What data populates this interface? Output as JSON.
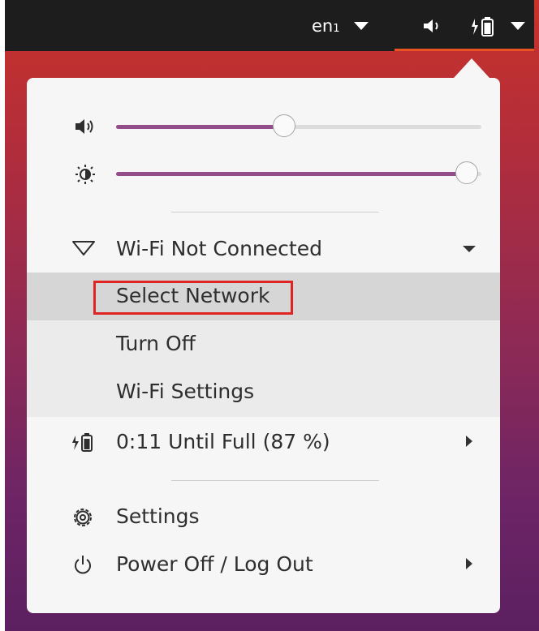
{
  "topbar": {
    "lang_main": "en",
    "lang_sub": "1",
    "icons": [
      "volume-icon",
      "battery-charging-icon",
      "chevron-down-icon"
    ]
  },
  "menu": {
    "volume_level_percent": 46,
    "brightness_level_percent": 96,
    "wifi": {
      "label": "Wi-Fi Not Connected",
      "submenu": [
        {
          "label": "Select Network"
        },
        {
          "label": "Turn Off"
        },
        {
          "label": "Wi-Fi Settings"
        }
      ]
    },
    "battery_label": "0:11 Until Full (87 %)",
    "settings_label": "Settings",
    "power_label": "Power Off / Log Out"
  },
  "colors": {
    "topbar": "#1d1d1d",
    "accent": "#e95420",
    "slider_fill": "#924d8b",
    "highlight_box": "#e02424"
  }
}
